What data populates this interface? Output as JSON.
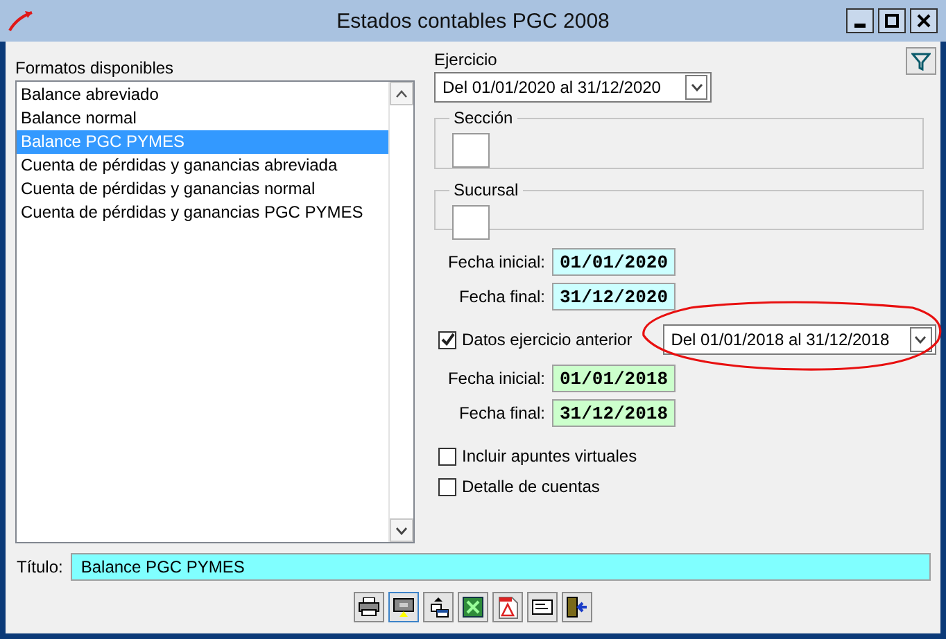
{
  "window": {
    "title": "Estados contables PGC 2008"
  },
  "formats": {
    "label": "Formatos disponibles",
    "items": [
      {
        "label": "Balance abreviado",
        "selected": false
      },
      {
        "label": "Balance normal",
        "selected": false
      },
      {
        "label": "Balance PGC PYMES",
        "selected": true
      },
      {
        "label": "Cuenta de pérdidas y ganancias abreviada",
        "selected": false
      },
      {
        "label": "Cuenta de pérdidas y ganancias normal",
        "selected": false
      },
      {
        "label": "Cuenta de pérdidas y ganancias PGC PYMES",
        "selected": false
      }
    ]
  },
  "ejercicio": {
    "label": "Ejercicio",
    "value": "Del 01/01/2020 al 31/12/2020"
  },
  "groups": [
    {
      "label": "Sección"
    },
    {
      "label": "Sucursal"
    }
  ],
  "current_dates": [
    {
      "label": "Fecha inicial:",
      "value": "01/01/2020"
    },
    {
      "label": "Fecha final:",
      "value": "31/12/2020"
    }
  ],
  "previous": {
    "label": "Datos ejercicio anterior",
    "checked": true,
    "value": "Del 01/01/2018 al 31/12/2018",
    "circled": true
  },
  "previous_dates": [
    {
      "label": "Fecha inicial:",
      "value": "01/01/2018"
    },
    {
      "label": "Fecha final:",
      "value": "31/12/2018"
    }
  ],
  "options": [
    {
      "label": "Incluir apuntes virtuales",
      "checked": false
    },
    {
      "label": "Detalle de cuentas",
      "checked": false
    }
  ],
  "title_field": {
    "label": "Título:",
    "value": "Balance PGC PYMES"
  },
  "toolbar": [
    {
      "kind": "print",
      "selected": false
    },
    {
      "kind": "screen",
      "selected": true
    },
    {
      "kind": "export",
      "selected": false
    },
    {
      "kind": "excel",
      "selected": false
    },
    {
      "kind": "pdf",
      "selected": false
    },
    {
      "kind": "mail",
      "selected": false
    },
    {
      "kind": "exit",
      "selected": false
    }
  ]
}
